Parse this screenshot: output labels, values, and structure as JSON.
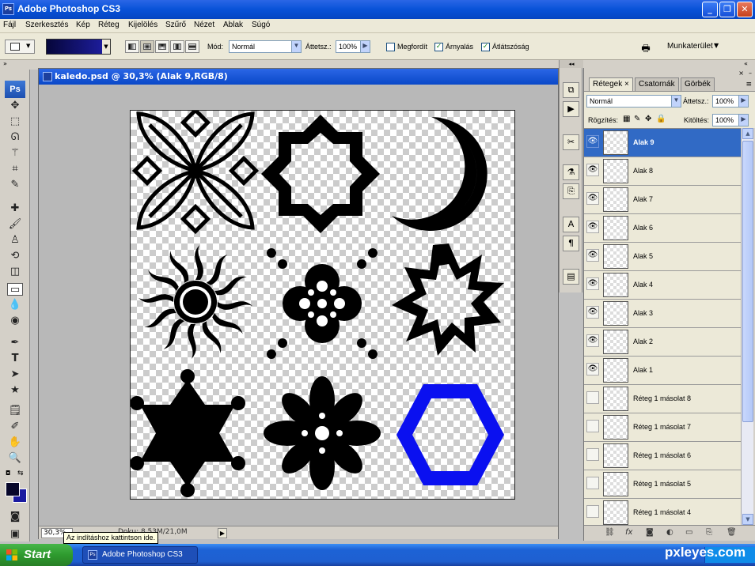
{
  "app": {
    "title": "Adobe Photoshop CS3",
    "badge": "Ps"
  },
  "menu": [
    "Fájl",
    "Szerkesztés",
    "Kép",
    "Réteg",
    "Kijelölés",
    "Szűrő",
    "Nézet",
    "Ablak",
    "Súgó"
  ],
  "options": {
    "mode_label": "Mód:",
    "mode_value": "Normál",
    "opacity_label": "Áttetsz.:",
    "opacity_value": "100%",
    "reverse_label": "Megfordít",
    "dither_label": "Árnyalás",
    "transparency_label": "Átlátszóság",
    "workspace_label": "Munkaterület"
  },
  "toolbox": {
    "logo": "Ps"
  },
  "document": {
    "title": "kaledo.psd @ 30,3% (Alak 9,RGB/8)",
    "zoom": "30,3%",
    "info": "Doku: 8,53M/21,0M"
  },
  "shapes": [
    {
      "name": "petal-flower",
      "color": "#000000"
    },
    {
      "name": "octagram",
      "color": "#000000"
    },
    {
      "name": "crescent",
      "color": "#000000"
    },
    {
      "name": "sun",
      "color": "#000000"
    },
    {
      "name": "clover-flower",
      "color": "#000000"
    },
    {
      "name": "starburst",
      "color": "#000000"
    },
    {
      "name": "six-point-star",
      "color": "#000000"
    },
    {
      "name": "daisy",
      "color": "#000000"
    },
    {
      "name": "hexagon-ring",
      "color": "#0a10f0"
    }
  ],
  "panel": {
    "tabs": [
      "Rétegek",
      "Csatornák",
      "Görbék"
    ],
    "blend_mode": "Normál",
    "opacity_label": "Áttetsz.:",
    "opacity_value": "100%",
    "lock_label": "Rögzítés:",
    "fill_label": "Kitöltés:",
    "fill_value": "100%",
    "layers": [
      {
        "name": "Alak 9",
        "visible": true,
        "selected": true
      },
      {
        "name": "Alak 8",
        "visible": true,
        "selected": false
      },
      {
        "name": "Alak 7",
        "visible": true,
        "selected": false
      },
      {
        "name": "Alak 6",
        "visible": true,
        "selected": false
      },
      {
        "name": "Alak 5",
        "visible": true,
        "selected": false
      },
      {
        "name": "Alak 4",
        "visible": true,
        "selected": false
      },
      {
        "name": "Alak 3",
        "visible": true,
        "selected": false
      },
      {
        "name": "Alak 2",
        "visible": true,
        "selected": false
      },
      {
        "name": "Alak 1",
        "visible": true,
        "selected": false
      },
      {
        "name": "Réteg 1 másolat 8",
        "visible": false,
        "selected": false
      },
      {
        "name": "Réteg 1 másolat 7",
        "visible": false,
        "selected": false
      },
      {
        "name": "Réteg 1 másolat 6",
        "visible": false,
        "selected": false
      },
      {
        "name": "Réteg 1 másolat 5",
        "visible": false,
        "selected": false
      },
      {
        "name": "Réteg 1 másolat 4",
        "visible": false,
        "selected": false
      }
    ]
  },
  "tooltip": "Az indításhoz kattintson ide.",
  "taskbar": {
    "start": "Start",
    "item": "Adobe Photoshop CS3"
  },
  "watermark": "pxleyes.com"
}
